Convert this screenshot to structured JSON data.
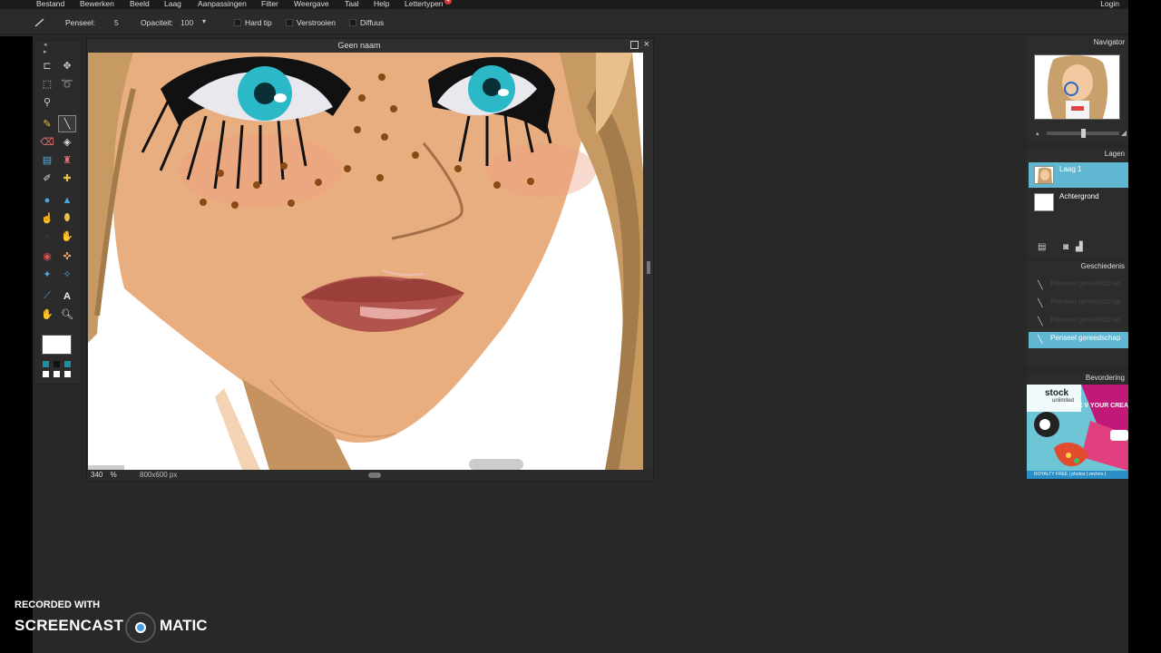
{
  "menu": {
    "items": [
      "Bestand",
      "Bewerken",
      "Beeld",
      "Laag",
      "Aanpassingen",
      "Filter",
      "Weergave",
      "Taal",
      "Help",
      "Lettertypen"
    ],
    "badge": "4",
    "login": "Login"
  },
  "options": {
    "brush_label": "Penseel:",
    "brush_value": "5",
    "opacity_label": "Opaciteit:",
    "opacity_value": "100",
    "hard_tip": "Hard tip",
    "blur": "Verstrooien",
    "diffuse": "Diffuus"
  },
  "canvas": {
    "title": "Geen naam",
    "zoom": "340",
    "zoom_unit": "%",
    "size": "800x600 px"
  },
  "panels": {
    "navigator": "Navigator",
    "layers": "Lagen",
    "layer_items": [
      "Laag 1",
      "Achtergrond"
    ],
    "history": "Geschiedenis",
    "history_items": [
      "Penseel gereedschap",
      "Penseel gereedschap",
      "Penseel gereedschap",
      "Penseel gereedschap"
    ],
    "promo": "Bevordering"
  },
  "promo_ad": {
    "brand": "stock",
    "brand_sub": "unlimited",
    "headline": "FREE V YOUR CREA",
    "footer": "ROYALTY FREE | photos | vectors |"
  },
  "watermark": {
    "recorded": "RECORDED WITH",
    "brand_left": "SCREENCAST",
    "brand_right": "MATIC"
  },
  "colors": {
    "accent": "#5fb7d1",
    "skin": "#e9ae7f",
    "eye": "#2bb8c7"
  }
}
